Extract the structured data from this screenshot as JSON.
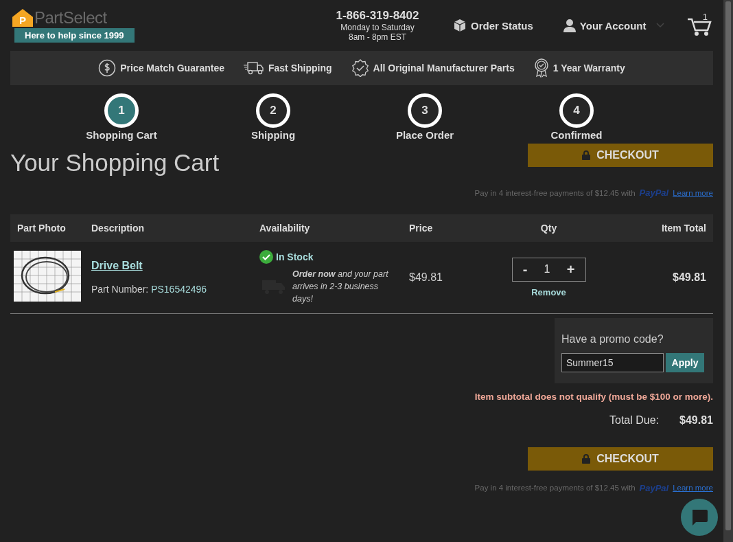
{
  "header": {
    "logo_letter": "P",
    "logo_text": "PartSelect",
    "tagline": "Here to help since 1999",
    "phone": "1-866-319-8402",
    "hours": [
      "Monday to Saturday",
      "8am - 8pm EST"
    ],
    "order_status": "Order Status",
    "account": "Your Account",
    "cart_count": "1"
  },
  "benefits": [
    {
      "kind": "dollar",
      "label": "Price Match Guarantee"
    },
    {
      "kind": "truck",
      "label": "Fast Shipping"
    },
    {
      "kind": "badge",
      "label": "All Original Manufacturer Parts"
    },
    {
      "kind": "ribbon",
      "label": "1 Year Warranty"
    }
  ],
  "steps": [
    {
      "number": "1",
      "label": "Shopping Cart",
      "selected": true
    },
    {
      "number": "2",
      "label": "Shipping",
      "selected": false
    },
    {
      "number": "3",
      "label": "Place Order",
      "selected": false
    },
    {
      "number": "4",
      "label": "Confirmed",
      "selected": false
    }
  ],
  "title": "Your Shopping Cart",
  "checkout": "CHECKOUT",
  "paypal": {
    "text": "Pay in 4 interest-free payments of $12.45 with",
    "brand": "PayPal",
    "link": "Learn more"
  },
  "table": {
    "columns": [
      "Part Photo",
      "Description",
      "Availability",
      "Price",
      "Qty",
      "Item Total"
    ],
    "rows": [
      {
        "name": "Drive Belt",
        "part_label": "Part Number:",
        "part_number": "PS16542496",
        "stock": "In Stock",
        "shipping_note": "**Order now** and your part arrives in 2-3 business days!",
        "price": "$49.81",
        "minus": "-",
        "qty": "1",
        "plus": "+",
        "remove": "Remove",
        "total": "$49.81"
      }
    ]
  },
  "promo": {
    "heading": "Have a promo code?",
    "value": "Summer15",
    "button": "Apply",
    "error": "Item subtotal does not qualify (must be $100 or more)."
  },
  "total": {
    "label": "Total Due:",
    "value": "$49.81"
  },
  "checkout_bottom": "CHECKOUT",
  "paypal_bottom": {
    "text": "Pay in 4 interest-free payments of $12.45 with",
    "brand": "PayPal",
    "link": "Learn more"
  }
}
